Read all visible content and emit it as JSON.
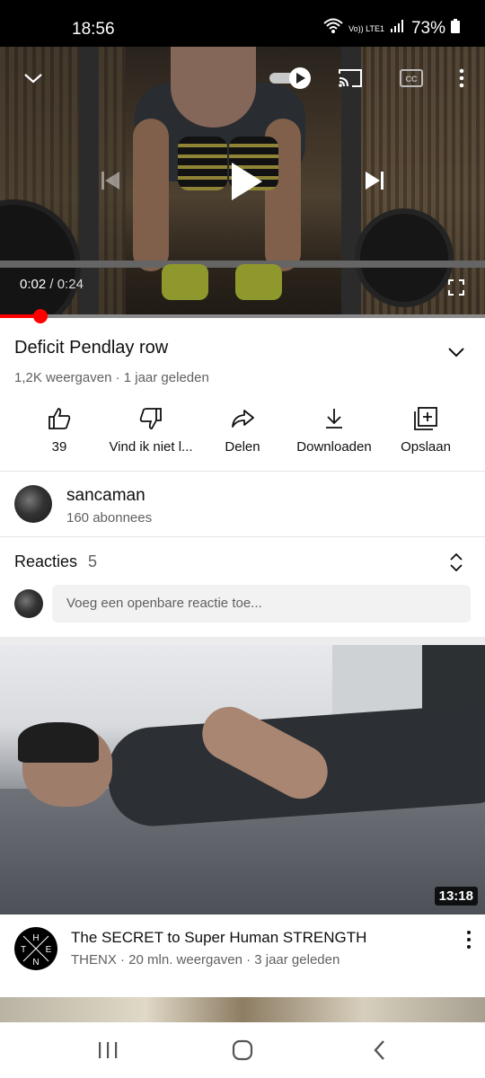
{
  "status_bar": {
    "time": "18:56",
    "volte": "Vo)) LTE1",
    "battery": "73%"
  },
  "player": {
    "current_time": "0:02",
    "separator": " / ",
    "duration": "0:24",
    "progress": 0.083,
    "autoplay_on": true
  },
  "video": {
    "title": "Deficit Pendlay row",
    "meta": "1,2K weergaven · 1 jaar geleden"
  },
  "actions": [
    {
      "icon": "thumbs-up-icon",
      "label": "39"
    },
    {
      "icon": "thumbs-down-icon",
      "label": "Vind ik niet l..."
    },
    {
      "icon": "share-icon",
      "label": "Delen"
    },
    {
      "icon": "download-icon",
      "label": "Downloaden"
    },
    {
      "icon": "save-playlist-icon",
      "label": "Opslaan"
    }
  ],
  "channel": {
    "name": "sancaman",
    "subscribers": "160 abonnees"
  },
  "comments": {
    "header": "Reacties",
    "count": "5",
    "placeholder": "Voeg een openbare reactie toe..."
  },
  "recommended": {
    "duration": "13:18",
    "title": "The SECRET to Super Human STRENGTH",
    "meta": "THENX · 20 mln. weergaven · 3 jaar geleden",
    "channel_logo_letters": {
      "top": "H",
      "left": "T",
      "right": "E",
      "bottom": "N"
    }
  },
  "colors": {
    "accent": "#ff0000",
    "text": "#0f0f0f",
    "secondary": "#606060"
  }
}
